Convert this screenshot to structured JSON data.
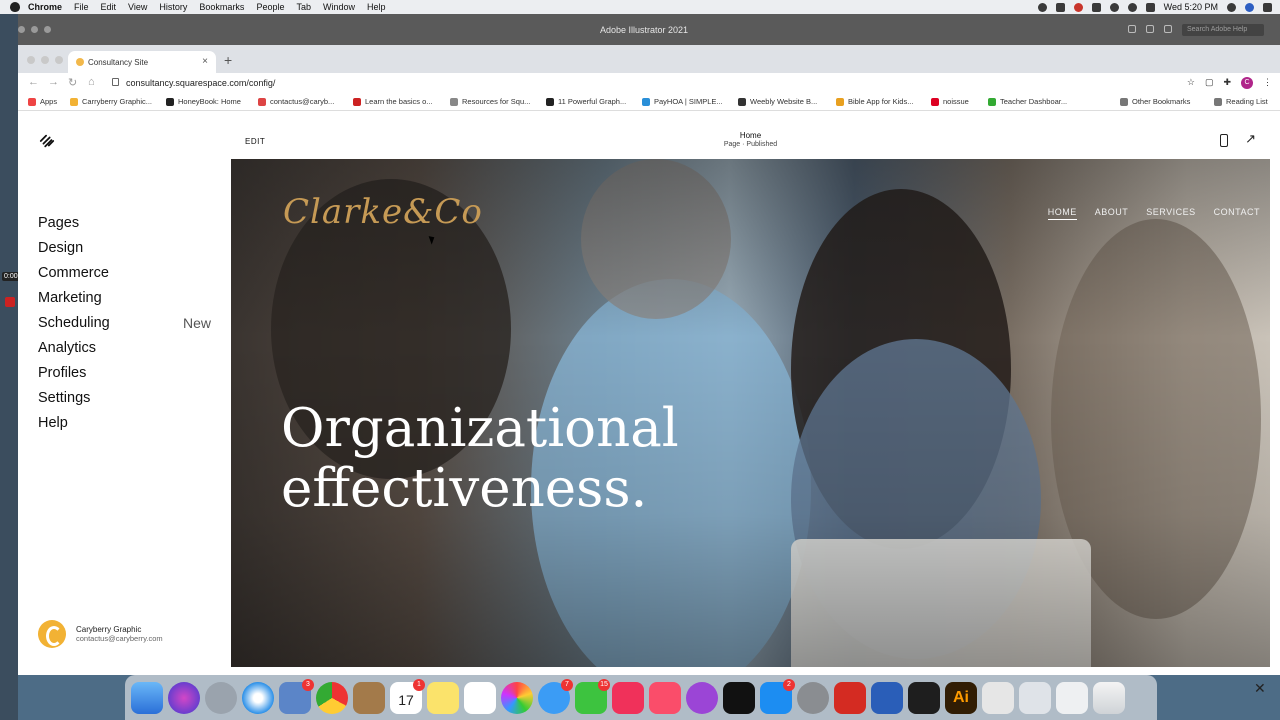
{
  "menubar": {
    "app": "Chrome",
    "items": [
      "File",
      "Edit",
      "View",
      "History",
      "Bookmarks",
      "People",
      "Tab",
      "Window",
      "Help"
    ],
    "clock": "Wed 5:20 PM"
  },
  "illustrator": {
    "title": "Adobe Illustrator 2021",
    "search_placeholder": "Search Adobe Help"
  },
  "recorder": {
    "time": "0:00"
  },
  "browser": {
    "tab_title": "Consultancy Site",
    "url": "consultancy.squarespace.com/config/",
    "avatar_letter": "C",
    "bookmarks": [
      {
        "label": "Apps",
        "color": "#e44"
      },
      {
        "label": "Carryberry Graphic...",
        "color": "#f2b234"
      },
      {
        "label": "HoneyBook: Home",
        "color": "#222"
      },
      {
        "label": "contactus@caryb...",
        "color": "#d44"
      },
      {
        "label": "Learn the basics o...",
        "color": "#c22"
      },
      {
        "label": "Resources for Squ...",
        "color": "#888"
      },
      {
        "label": "11 Powerful Graph...",
        "color": "#222"
      },
      {
        "label": "PayHOA | SIMPLE...",
        "color": "#2a8fd8"
      },
      {
        "label": "Weebly Website B...",
        "color": "#333"
      },
      {
        "label": "Bible App for Kids...",
        "color": "#e8a020"
      },
      {
        "label": "noissue",
        "color": "#d02"
      },
      {
        "label": "Teacher Dashboar...",
        "color": "#3a3"
      },
      {
        "label": "Other Bookmarks",
        "color": "#777"
      },
      {
        "label": "Reading List",
        "color": "#777"
      }
    ]
  },
  "squarespace": {
    "nav": [
      {
        "label": "Pages"
      },
      {
        "label": "Design"
      },
      {
        "label": "Commerce"
      },
      {
        "label": "Marketing"
      },
      {
        "label": "Scheduling",
        "badge": "New"
      },
      {
        "label": "Analytics"
      },
      {
        "label": "Profiles"
      },
      {
        "label": "Settings"
      },
      {
        "label": "Help"
      }
    ],
    "account": {
      "name": "Caryberry Graphic",
      "email": "contactus@caryberry.com"
    }
  },
  "editor": {
    "edit_label": "EDIT",
    "page_title": "Home",
    "page_status": "Page · Published"
  },
  "site": {
    "logo_text": "Clarke&Co",
    "nav": [
      "HOME",
      "ABOUT",
      "SERVICES",
      "CONTACT"
    ],
    "headline_1": "Organizational",
    "headline_2": "effectiveness."
  },
  "dock": {
    "badges": {
      "calendar_date": "17",
      "calendar_badge": "1",
      "mail_badge": "7",
      "facetime_badge": "15",
      "preview_badge": "3",
      "appstore_badge": "2"
    }
  },
  "colors": {
    "accent_logo": "#c69a55",
    "hero_text": "#ffffff",
    "sq_panel_bg": "#ffffff"
  }
}
